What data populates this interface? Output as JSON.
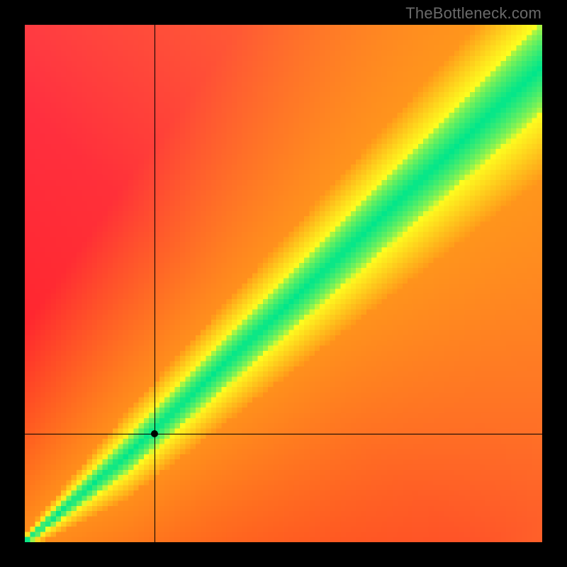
{
  "watermark": "TheBottleneck.com",
  "colors": {
    "background": "#000000",
    "green": "#00e68b",
    "yellow": "#fdfd1f",
    "orange": "#ff9a1a",
    "red_tl": "#ff3246",
    "red_bl": "#ff1e1e",
    "red_br": "#ff5a2a",
    "crosshair": "#000000",
    "point": "#000000",
    "watermark_text": "#6a6a6a"
  },
  "layout": {
    "image_size": 800,
    "border": 35,
    "plot_size": 730,
    "pixel_grid": 100
  },
  "chart_data": {
    "type": "heatmap",
    "title": "",
    "xlabel": "",
    "ylabel": "",
    "xlim": [
      0,
      100
    ],
    "ylim": [
      0,
      100
    ],
    "point": {
      "x": 25,
      "y": 21
    },
    "crosshair": {
      "x": 25,
      "y": 21
    },
    "diagonal_band": {
      "breakpoints_x": [
        0,
        20,
        100
      ],
      "center_y": [
        0,
        17,
        92
      ],
      "half_width": [
        0.7,
        3.5,
        9
      ],
      "note": "green band center and half-width (in axis units) at the given x breakpoints; linearly interpolated"
    },
    "background_gradient": {
      "top_left": "red",
      "bottom_left": "red",
      "bottom_right": "red-orange",
      "top_right": "green",
      "band": "green surrounded by yellow falloff"
    }
  }
}
